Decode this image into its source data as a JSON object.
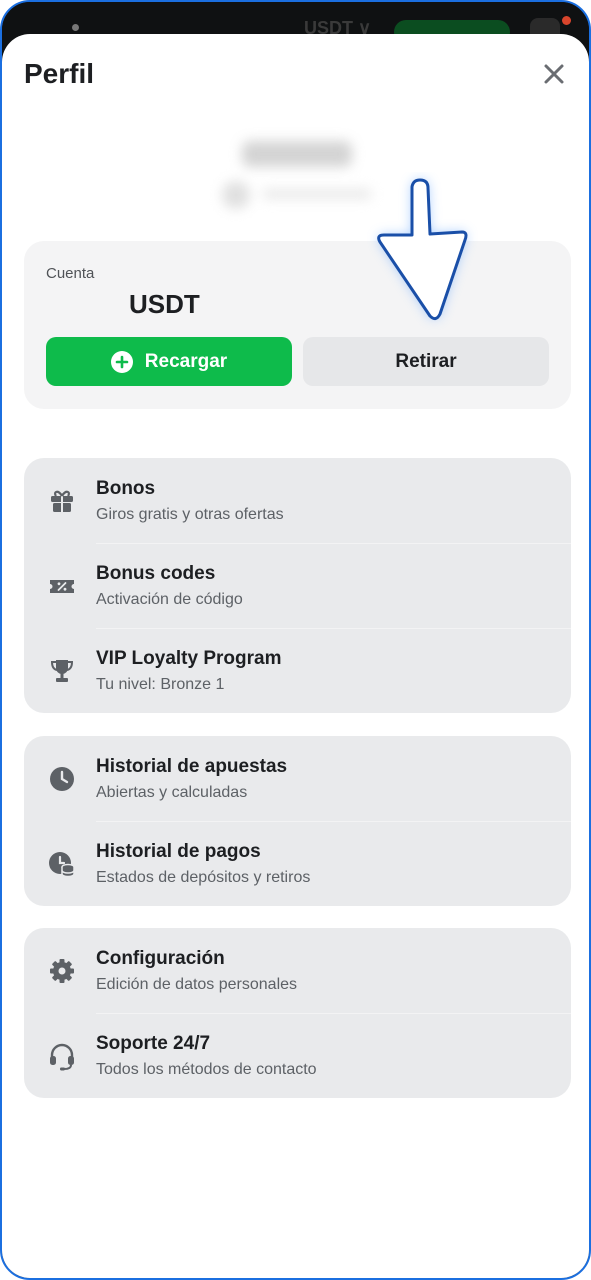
{
  "topbar": {
    "currency": "USDT ∨"
  },
  "header": {
    "title": "Perfil"
  },
  "account": {
    "label": "Cuenta",
    "currency": "USDT",
    "deposit_label": "Recargar",
    "withdraw_label": "Retirar"
  },
  "groups": [
    {
      "items": [
        {
          "title": "Bonos",
          "subtitle": "Giros gratis y otras ofertas",
          "icon": "gift-icon"
        },
        {
          "title": "Bonus codes",
          "subtitle": "Activación de código",
          "icon": "ticket-icon"
        },
        {
          "title": "VIP Loyalty Program",
          "subtitle": "Tu nivel: Bronze 1",
          "icon": "trophy-icon"
        }
      ]
    },
    {
      "items": [
        {
          "title": "Historial de apuestas",
          "subtitle": "Abiertas y calculadas",
          "icon": "clock-icon"
        },
        {
          "title": "Historial de pagos",
          "subtitle": "Estados de depósitos y retiros",
          "icon": "payment-history-icon"
        }
      ]
    },
    {
      "items": [
        {
          "title": "Configuración",
          "subtitle": "Edición de datos personales",
          "icon": "gear-icon"
        },
        {
          "title": "Soporte 24/7",
          "subtitle": "Todos los métodos de contacto",
          "icon": "headset-icon"
        }
      ]
    }
  ],
  "colors": {
    "accent_green": "#0ebb4b",
    "card_bg": "#e9eaec",
    "frame_border": "#1b6fe0",
    "icon_gray": "#5d6166"
  }
}
